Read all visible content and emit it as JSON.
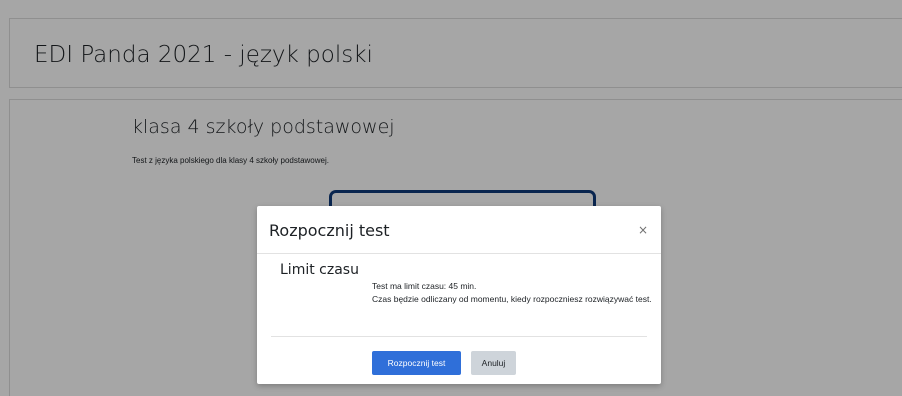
{
  "course": {
    "title": "EDI Panda 2021 - język polski"
  },
  "quiz": {
    "title": "klasa 4 szkoły podstawowej",
    "intro": "Test z języka polskiego dla klasy 4 szkoły podstawowej."
  },
  "modal": {
    "title": "Rozpocznij test",
    "close_glyph": "×",
    "close_icon": "close-icon",
    "section_heading": "Limit czasu",
    "limit_line": "Test ma limit czasu: 45 min.",
    "info_line": "Czas będzie odliczany od momentu, kiedy rozpoczniesz rozwiązywać test.",
    "start_label": "Rozpocznij test",
    "cancel_label": "Anuluj"
  },
  "colors": {
    "primary_button": "#2f6fd9",
    "secondary_button": "#ced4da",
    "quiz_frame_border": "#0f3a7a"
  }
}
